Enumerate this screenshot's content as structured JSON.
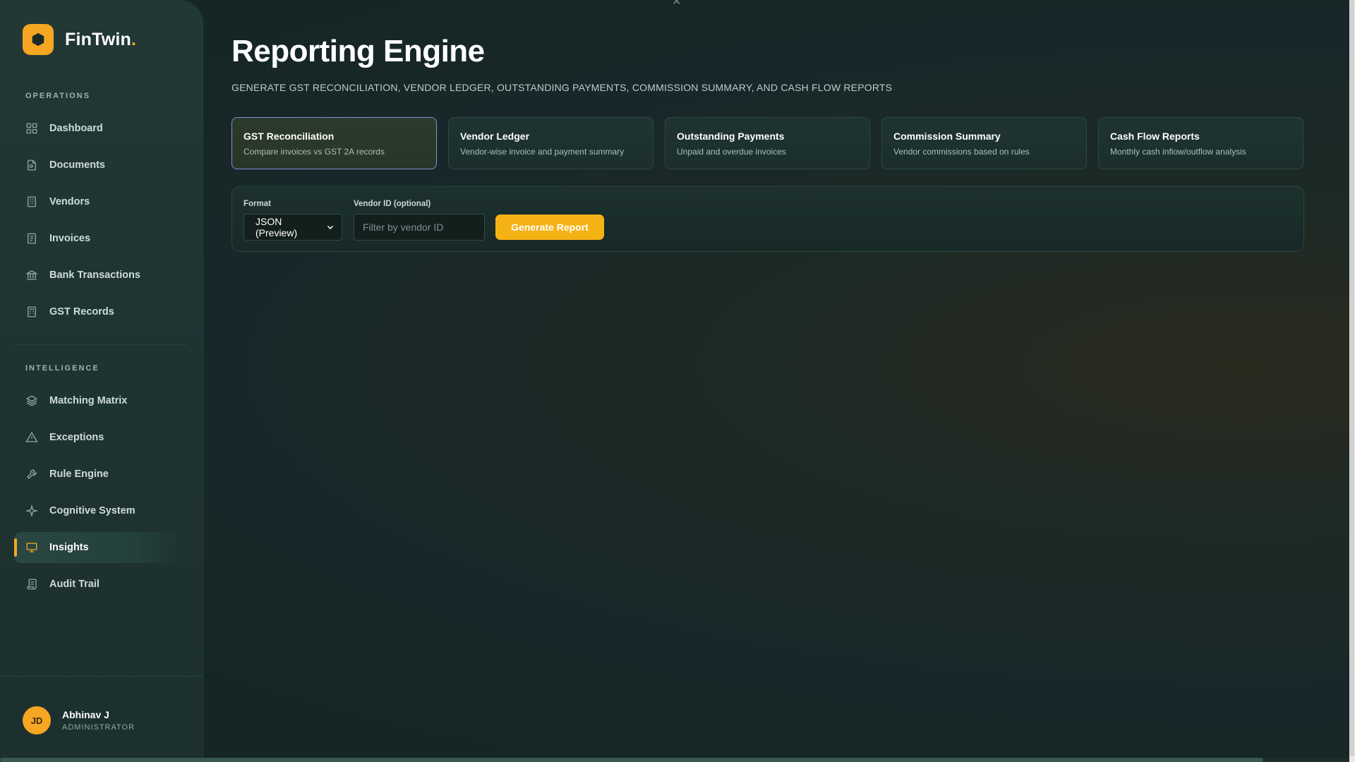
{
  "brand": {
    "name": "FinTwin",
    "dot": "."
  },
  "sidebar": {
    "sections": [
      {
        "label": "OPERATIONS"
      },
      {
        "label": "INTELLIGENCE"
      }
    ],
    "items": [
      {
        "label": "Dashboard",
        "icon": "grid-icon"
      },
      {
        "label": "Documents",
        "icon": "document-icon"
      },
      {
        "label": "Vendors",
        "icon": "building-icon"
      },
      {
        "label": "Invoices",
        "icon": "invoice-icon"
      },
      {
        "label": "Bank Transactions",
        "icon": "bank-icon"
      },
      {
        "label": "GST Records",
        "icon": "calculator-icon"
      },
      {
        "label": "Matching Matrix",
        "icon": "layers-icon"
      },
      {
        "label": "Exceptions",
        "icon": "warning-icon"
      },
      {
        "label": "Rule Engine",
        "icon": "wrench-icon"
      },
      {
        "label": "Cognitive System",
        "icon": "sparkle-icon"
      },
      {
        "label": "Insights",
        "icon": "presentation-icon",
        "active": true
      },
      {
        "label": "Audit Trail",
        "icon": "scroll-icon"
      }
    ]
  },
  "user": {
    "initials": "JD",
    "name": "Abhinav J",
    "role": "ADMINISTRATOR"
  },
  "page": {
    "title": "Reporting Engine",
    "subtitle": "GENERATE GST RECONCILIATION, VENDOR LEDGER, OUTSTANDING PAYMENTS, COMMISSION SUMMARY, AND CASH FLOW REPORTS"
  },
  "report_types": [
    {
      "title": "GST Reconciliation",
      "desc": "Compare invoices vs GST 2A records",
      "active": true
    },
    {
      "title": "Vendor Ledger",
      "desc": "Vendor-wise invoice and payment summary"
    },
    {
      "title": "Outstanding Payments",
      "desc": "Unpaid and overdue invoices"
    },
    {
      "title": "Commission Summary",
      "desc": "Vendor commissions based on rules"
    },
    {
      "title": "Cash Flow Reports",
      "desc": "Monthly cash inflow/outflow analysis"
    }
  ],
  "controls": {
    "format_label": "Format",
    "format_value": "JSON (Preview)",
    "vendor_label": "Vendor ID (optional)",
    "vendor_placeholder": "Filter by vendor ID",
    "generate_label": "Generate Report"
  },
  "colors": {
    "accent": "#f5a623",
    "active_border": "#7f8fd6"
  }
}
